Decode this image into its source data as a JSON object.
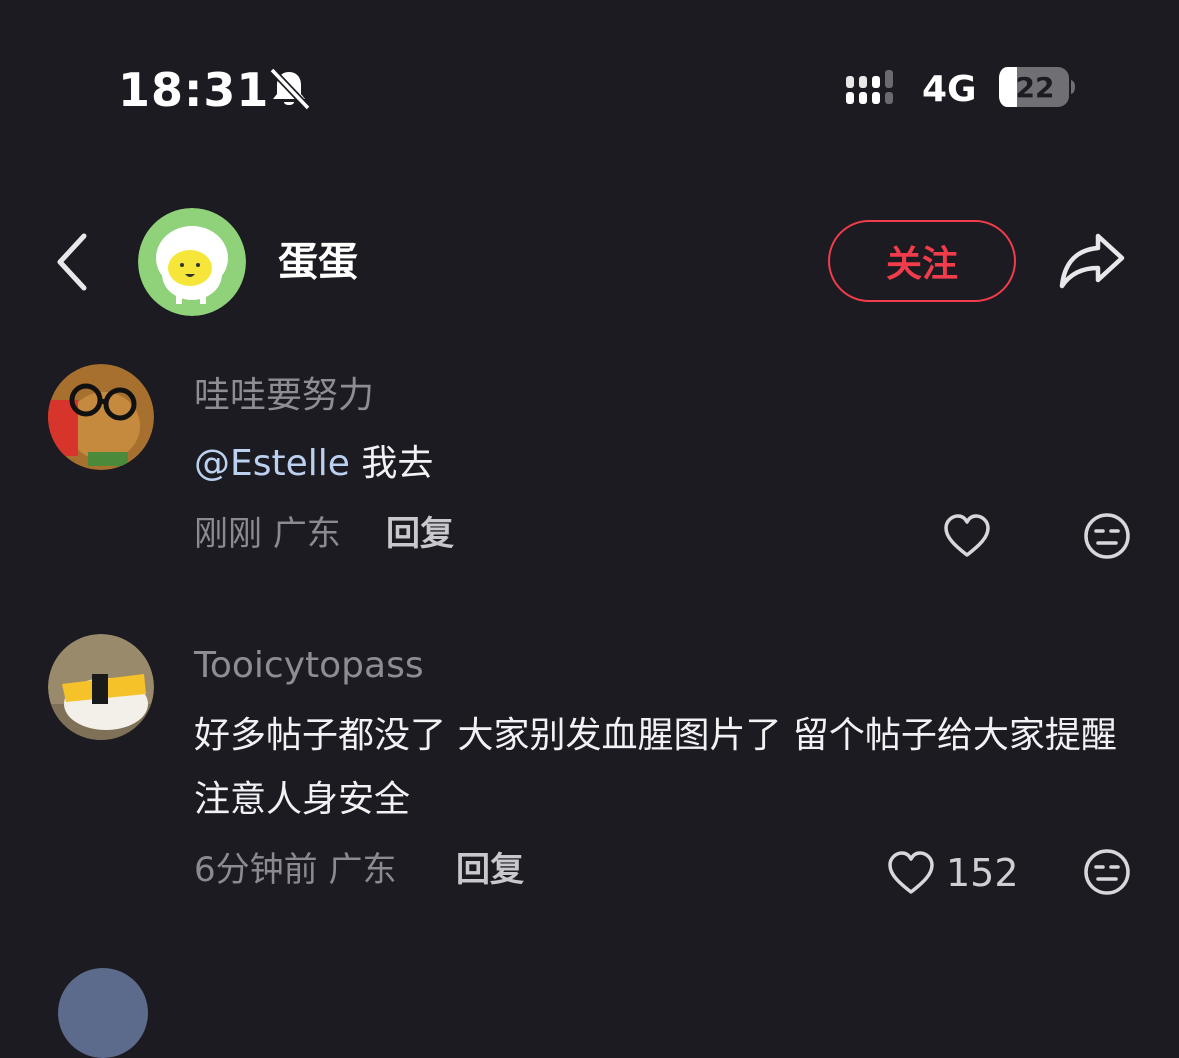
{
  "status_bar": {
    "time": "18:31",
    "network": "4G",
    "battery": "22",
    "icons": [
      "bell-slash-icon",
      "signal-icon",
      "battery-icon"
    ]
  },
  "header": {
    "username": "蛋蛋",
    "follow_label": "关注",
    "icons": [
      "back-arrow-icon",
      "share-arrow-icon"
    ]
  },
  "comments": [
    {
      "user": "哇哇要努力",
      "mention": "@Estelle",
      "text": "我去",
      "time": "刚刚",
      "location": "广东",
      "reply_label": "回复",
      "likes": ""
    },
    {
      "user": "Tooicytopass",
      "mention": "",
      "text": "好多帖子都没了 大家别发血腥图片了 留个帖子给大家提醒注意人身安全",
      "time": "6分钟前",
      "location": "广东",
      "reply_label": "回复",
      "likes": "152"
    }
  ],
  "colors": {
    "background": "#1b1b21",
    "accent": "#f03c4b",
    "mention": "#bcd1ef"
  }
}
